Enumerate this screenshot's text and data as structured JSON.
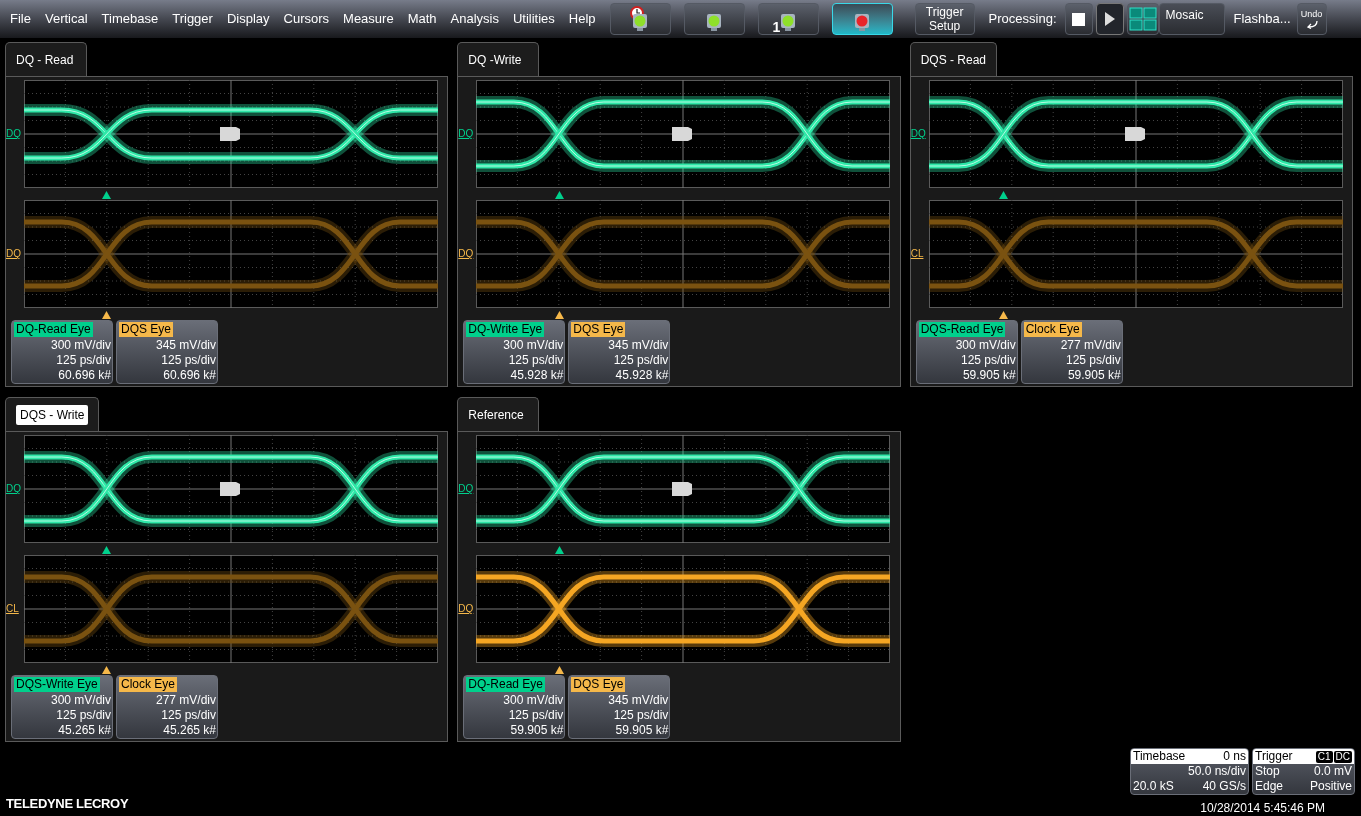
{
  "menu": [
    "File",
    "Vertical",
    "Timebase",
    "Trigger",
    "Display",
    "Cursors",
    "Measure",
    "Math",
    "Analysis",
    "Utilities",
    "Help"
  ],
  "toolbar_buttons": [
    {
      "kind": "alarm",
      "selected": false
    },
    {
      "kind": "light",
      "selected": false
    },
    {
      "kind": "light",
      "badge": "1",
      "selected": false
    },
    {
      "kind": "stop-light",
      "selected": true
    }
  ],
  "trigger_setup": "Trigger Setup",
  "processing_label": "Processing:",
  "play_selected": true,
  "layout": "Mosaic",
  "flashback": "Flashba...",
  "undo": "Undo",
  "panels": [
    {
      "tab": "DQ - Read",
      "selected": false,
      "traces": [
        {
          "label": "DQ",
          "color": "#2ee8a8"
        },
        {
          "label": "DQ",
          "color": "#7a5210"
        }
      ],
      "descriptors": [
        {
          "name": "DQ-Read Eye",
          "color": "#00d08c",
          "vdiv": "300 mV/div",
          "tdiv": "125 ps/div",
          "count": "60.696 k#"
        },
        {
          "name": "DQS Eye",
          "color": "#f5b84a",
          "vdiv": "345 mV/div",
          "tdiv": "125 ps/div",
          "count": "60.696 k#"
        }
      ]
    },
    {
      "tab": "DQ -Write",
      "selected": false,
      "traces": [
        {
          "label": "DQ",
          "color": "#2ee8a8"
        },
        {
          "label": "DQ",
          "color": "#7a5210"
        }
      ],
      "descriptors": [
        {
          "name": "DQ-Write Eye",
          "color": "#00d08c",
          "vdiv": "300 mV/div",
          "tdiv": "125 ps/div",
          "count": "45.928 k#"
        },
        {
          "name": "DQS Eye",
          "color": "#f5b84a",
          "vdiv": "345 mV/div",
          "tdiv": "125 ps/div",
          "count": "45.928 k#"
        }
      ]
    },
    {
      "tab": "DQS - Read",
      "selected": false,
      "traces": [
        {
          "label": "DQ",
          "color": "#2ee8a8"
        },
        {
          "label": "CL",
          "color": "#7a5210"
        }
      ],
      "descriptors": [
        {
          "name": "DQS-Read Eye",
          "color": "#00d08c",
          "vdiv": "300 mV/div",
          "tdiv": "125 ps/div",
          "count": "59.905 k#"
        },
        {
          "name": "Clock Eye",
          "color": "#f5b84a",
          "vdiv": "277 mV/div",
          "tdiv": "125 ps/div",
          "count": "59.905 k#"
        }
      ]
    },
    {
      "tab": "DQS - Write",
      "selected": true,
      "traces": [
        {
          "label": "DQ",
          "color": "#2ee8a8"
        },
        {
          "label": "CL",
          "color": "#7a5210"
        }
      ],
      "descriptors": [
        {
          "name": "DQS-Write Eye",
          "color": "#00d08c",
          "vdiv": "300 mV/div",
          "tdiv": "125 ps/div",
          "count": "45.265 k#"
        },
        {
          "name": "Clock Eye",
          "color": "#f5b84a",
          "vdiv": "277 mV/div",
          "tdiv": "125 ps/div",
          "count": "45.265 k#"
        }
      ]
    },
    {
      "tab": "Reference",
      "selected": false,
      "traces": [
        {
          "label": "DQ",
          "color": "#2ee8a8"
        },
        {
          "label": "DQ",
          "color": "#f5a623"
        }
      ],
      "descriptors": [
        {
          "name": "DQ-Read Eye",
          "color": "#00d08c",
          "vdiv": "300 mV/div",
          "tdiv": "125 ps/div",
          "count": "59.905 k#"
        },
        {
          "name": "DQS Eye",
          "color": "#f5b84a",
          "vdiv": "345 mV/div",
          "tdiv": "125 ps/div",
          "count": "59.905 k#"
        }
      ]
    }
  ],
  "timebase": {
    "title": "Timebase",
    "delay": "0 ns",
    "scale": "50.0 ns/div",
    "samples": "20.0 kS",
    "rate": "40 GS/s"
  },
  "trigger": {
    "title": "Trigger",
    "channel": "C1",
    "coupling": "DC",
    "mode": "Stop",
    "level": "0.0 mV",
    "type": "Edge",
    "slope": "Positive"
  },
  "timestamp": "10/28/2014 5:45:46 PM",
  "logo": "TELEDYNE LECROY"
}
